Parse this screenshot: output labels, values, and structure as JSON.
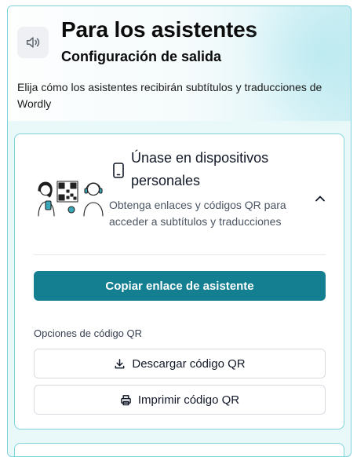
{
  "header": {
    "title": "Para los asistentes",
    "subtitle": "Configuración de salida",
    "description": "Elija cómo los asistentes recibirán subtítulos y traducciones de Wordly"
  },
  "card": {
    "title": "Únase en dispositivos personales",
    "subtitle": "Obtenga enlaces y códigos QR para acceder a subtítulos y traducciones",
    "copy_link_label": "Copiar enlace de asistente",
    "qr_section_label": "Opciones de código QR",
    "download_qr_label": "Descargar código QR",
    "print_qr_label": "Imprimir código QR"
  },
  "icons": {
    "header": "speaker-icon",
    "card": "smartphone-icon",
    "collapse": "chevron-up-icon",
    "download": "download-icon",
    "print": "printer-icon"
  },
  "colors": {
    "accent": "#137f91",
    "panel_border": "#7fd3dd",
    "panel_bg": "#e9f8f8"
  }
}
